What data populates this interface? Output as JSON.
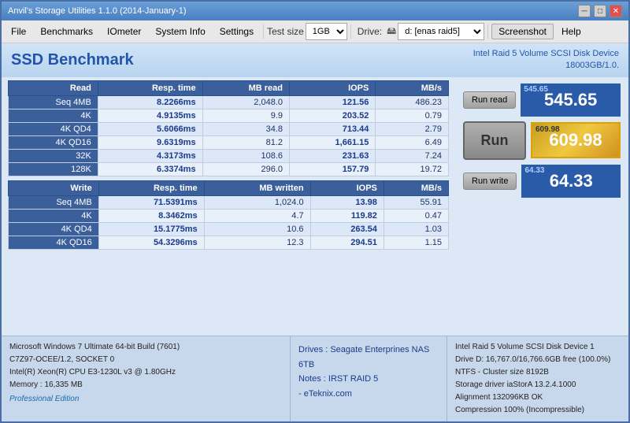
{
  "window": {
    "title": "Anvil's Storage Utilities 1.1.0 (2014-January-1)",
    "controls": {
      "minimize": "─",
      "maximize": "□",
      "close": "✕"
    }
  },
  "menu": {
    "items": [
      "File",
      "Benchmarks",
      "IOmeter",
      "System Info",
      "Settings"
    ],
    "testsize_label": "Test size",
    "testsize_value": "1GB",
    "drive_label": "Drive:",
    "drive_icon": "🖴",
    "drive_value": "d: [enas raid5]",
    "screenshot": "Screenshot",
    "help": "Help"
  },
  "header": {
    "title": "SSD Benchmark",
    "device_line1": "Intel Raid 5 Volume SCSI Disk Device",
    "device_line2": "18003GB/1.0."
  },
  "read_table": {
    "columns": [
      "Read",
      "Resp. time",
      "MB read",
      "IOPS",
      "MB/s"
    ],
    "rows": [
      [
        "Seq 4MB",
        "8.2266ms",
        "2,048.0",
        "121.56",
        "486.23"
      ],
      [
        "4K",
        "4.9135ms",
        "9.9",
        "203.52",
        "0.79"
      ],
      [
        "4K QD4",
        "5.6066ms",
        "34.8",
        "713.44",
        "2.79"
      ],
      [
        "4K QD16",
        "9.6319ms",
        "81.2",
        "1,661.15",
        "6.49"
      ],
      [
        "32K",
        "4.3173ms",
        "108.6",
        "231.63",
        "7.24"
      ],
      [
        "128K",
        "6.3374ms",
        "296.0",
        "157.79",
        "19.72"
      ]
    ]
  },
  "write_table": {
    "columns": [
      "Write",
      "Resp. time",
      "MB written",
      "IOPS",
      "MB/s"
    ],
    "rows": [
      [
        "Seq 4MB",
        "71.5391ms",
        "1,024.0",
        "13.98",
        "55.91"
      ],
      [
        "4K",
        "8.3462ms",
        "4.7",
        "119.82",
        "0.47"
      ],
      [
        "4K QD4",
        "15.1775ms",
        "10.6",
        "263.54",
        "1.03"
      ],
      [
        "4K QD16",
        "54.3296ms",
        "12.3",
        "294.51",
        "1.15"
      ]
    ]
  },
  "scores": {
    "read_score": "545.65",
    "read_small": "545.65",
    "total_score": "609.98",
    "total_small": "609.98",
    "write_score": "64.33",
    "write_small": "64.33"
  },
  "buttons": {
    "run_read": "Run read",
    "run": "Run",
    "run_write": "Run write"
  },
  "bottom": {
    "sys_line1": "Microsoft Windows 7 Ultimate  64-bit Build (7601)",
    "sys_line2": "C7Z97-OCEE/1.2, SOCKET 0",
    "sys_line3": "Intel(R) Xeon(R) CPU E3-1230L v3 @ 1.80GHz",
    "sys_line4": "Memory : 16,335 MB",
    "professional": "Professional Edition",
    "drives_label": "Drives : Seagate Enterprines NAS 6TB",
    "notes_label": "Notes : IRST RAID 5",
    "notes_sub": "- eTeknix.com",
    "right_line1": "Intel Raid 5 Volume SCSI Disk Device 1",
    "right_line2": "Drive D:  16,767.0/16,766.6GB free (100.0%)",
    "right_line3": "NTFS - Cluster size 8192B",
    "right_line4": "Storage driver  iaStorA 13.2.4.1000",
    "right_line5": "Alignment 132096KB OK",
    "right_line6": "Compression 100% (Incompressible)"
  }
}
